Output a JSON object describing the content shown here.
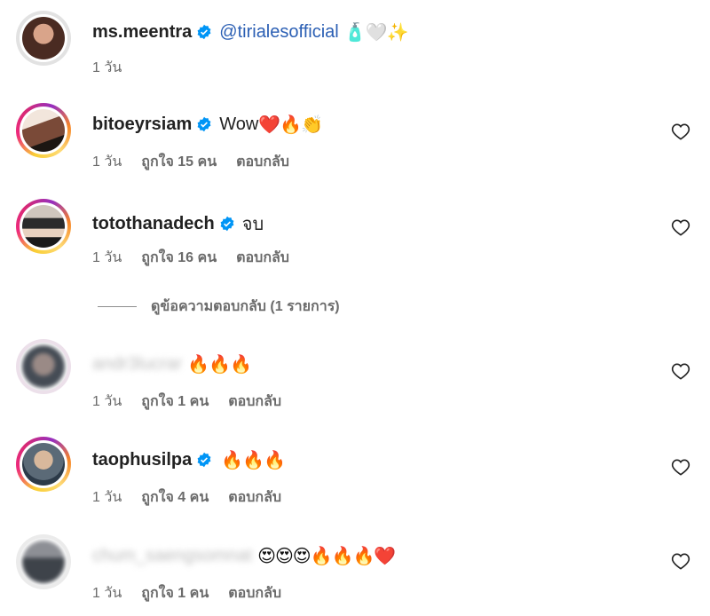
{
  "comments": [
    {
      "username": "ms.meentra",
      "verified": true,
      "mention": "@tirialesofficial",
      "text": "",
      "emojis": "🧴🤍✨",
      "time": "1 วัน",
      "likes": "",
      "reply": "",
      "has_heart": false
    },
    {
      "username": "bitoeyrsiam",
      "verified": true,
      "text": "Wow",
      "emojis": "❤️🔥👏",
      "time": "1 วัน",
      "likes": "ถูกใจ 15 คน",
      "reply": "ตอบกลับ",
      "has_heart": true
    },
    {
      "username": "totothanadech",
      "verified": true,
      "text": "จบ",
      "emojis": "",
      "time": "1 วัน",
      "likes": "ถูกใจ 16 คน",
      "reply": "ตอบกลับ",
      "has_heart": true
    },
    {
      "username": "andr3lucrar",
      "verified": false,
      "text": "",
      "emojis": "🔥🔥🔥",
      "time": "1 วัน",
      "likes": "ถูกใจ 1 คน",
      "reply": "ตอบกลับ",
      "has_heart": true
    },
    {
      "username": "taophusilpa",
      "verified": true,
      "text": "",
      "emojis": "🔥🔥🔥",
      "time": "1 วัน",
      "likes": "ถูกใจ 4 คน",
      "reply": "ตอบกลับ",
      "has_heart": true
    },
    {
      "username": "chum_saengsomnat",
      "verified": false,
      "text": "",
      "emojis": "😍😍😍🔥🔥🔥❤️",
      "time": "1 วัน",
      "likes": "ถูกใจ 1 คน",
      "reply": "ตอบกลับ",
      "has_heart": true
    }
  ],
  "view_replies": "ดูข้อความตอบกลับ (1 รายการ)",
  "colors": {
    "verified_blue": "#0095f6",
    "mention_blue": "#2b5fb4",
    "meta_gray": "#6b6b6b"
  },
  "icons": {
    "verified": "verified-badge-icon",
    "like": "heart-outline-icon"
  }
}
